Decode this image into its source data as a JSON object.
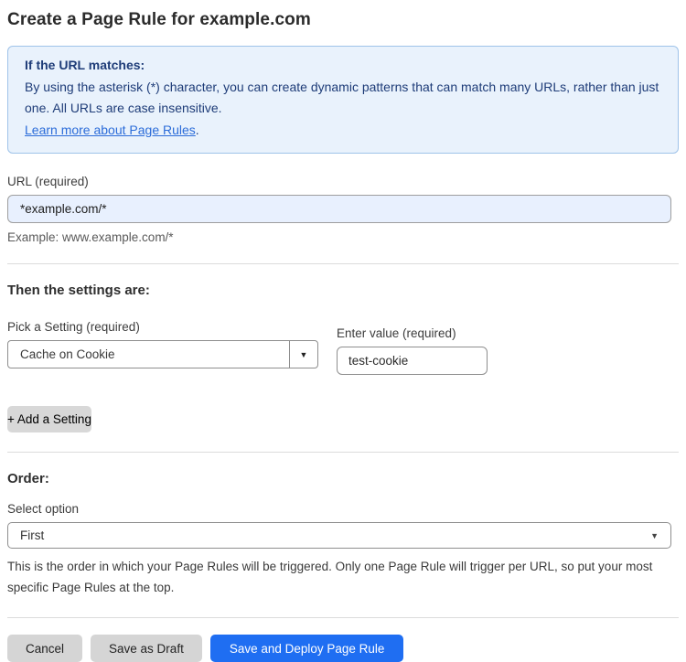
{
  "page": {
    "title": "Create a Page Rule for example.com"
  },
  "info_box": {
    "heading": "If the URL matches:",
    "body": "By using the asterisk (*) character, you can create dynamic patterns that can match many URLs, rather than just one. All URLs are case insensitive.",
    "link_text": "Learn more about Page Rules",
    "link_suffix": "."
  },
  "url_field": {
    "label": "URL (required)",
    "value": "*example.com/*",
    "helper": "Example: www.example.com/*"
  },
  "settings_section": {
    "heading": "Then the settings are:",
    "setting_select": {
      "label": "Pick a Setting (required)",
      "value": "Cache on Cookie"
    },
    "value_input": {
      "label": "Enter value (required)",
      "value": "test-cookie"
    },
    "add_setting_label": "+ Add a Setting"
  },
  "order_section": {
    "heading": "Order:",
    "select_label": "Select option",
    "selected_option": "First",
    "description": "This is the order in which your Page Rules will be triggered. Only one Page Rule will trigger per URL, so put your most specific Page Rules at the top."
  },
  "footer": {
    "cancel_label": "Cancel",
    "save_draft_label": "Save as Draft",
    "save_deploy_label": "Save and Deploy Page Rule"
  },
  "icons": {
    "dropdown_arrow": "▼"
  },
  "colors": {
    "accent_blue": "#1f6ef2",
    "info_box_bg": "#e9f2fc",
    "info_box_border": "#9fc3e9",
    "info_box_text": "#1e3c78",
    "link_blue": "#2b6cd9",
    "url_input_bg": "#e8f0fe",
    "gray_button_bg": "#d5d5d5"
  }
}
